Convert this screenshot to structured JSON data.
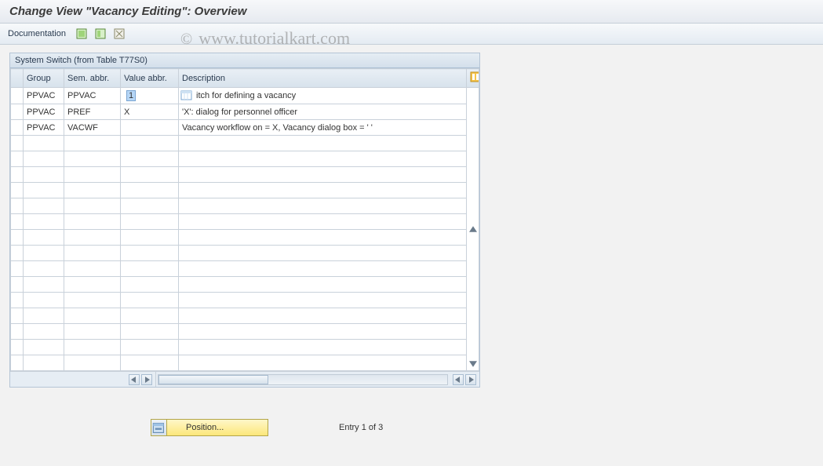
{
  "title": "Change View \"Vacancy Editing\": Overview",
  "toolbar": {
    "documentation_label": "Documentation"
  },
  "panel": {
    "header": "System Switch (from Table T77S0)",
    "columns": {
      "group": "Group",
      "sem": "Sem. abbr.",
      "val": "Value abbr.",
      "desc": "Description"
    },
    "rows": [
      {
        "group": "PPVAC",
        "sem": "PPVAC",
        "val": "1",
        "desc": "itch for defining a vacancy",
        "editing": true
      },
      {
        "group": "PPVAC",
        "sem": "PREF",
        "val": "X",
        "desc": "'X': dialog for personnel officer",
        "editing": false
      },
      {
        "group": "PPVAC",
        "sem": "VACWF",
        "val": "",
        "desc": "Vacancy workflow on = X, Vacancy dialog box = ' '",
        "editing": false
      }
    ]
  },
  "footer": {
    "position_label": "Position...",
    "entry_text": "Entry 1 of 3"
  },
  "watermark": "www.tutorialkart.com",
  "watermark_c": "©"
}
